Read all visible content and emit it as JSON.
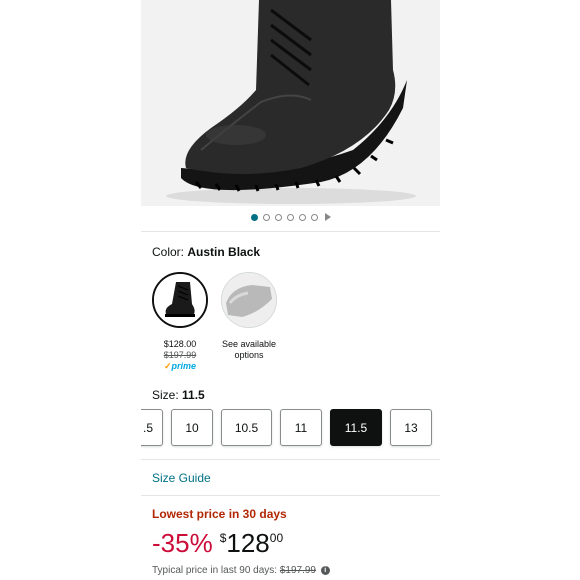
{
  "gallery": {
    "dot_count": 6,
    "active_index": 0,
    "play_icon": "play-icon"
  },
  "color": {
    "label": "Color:",
    "selected": "Austin Black",
    "swatches": [
      {
        "name": "austin-black",
        "price": "$128.00",
        "list_price": "$197.99",
        "prime": "prime"
      },
      {
        "name": "other",
        "availability_line1": "See available",
        "availability_line2": "options"
      }
    ]
  },
  "size": {
    "label": "Size:",
    "selected": "11.5",
    "options": [
      ".5",
      "10",
      "10.5",
      "11",
      "11.5",
      "13"
    ]
  },
  "size_guide": "Size Guide",
  "deal": {
    "badge": "Lowest price in 30 days",
    "discount": "-35%",
    "currency": "$",
    "price_whole": "128",
    "price_fraction": "00",
    "typical_label": "Typical price in last 90 days:",
    "typical_price": "$197.99"
  },
  "colors": {
    "link": "#007185",
    "deal_red": "#b12704",
    "discount_red": "#cc0c39",
    "selected_size_bg": "#0f1111"
  }
}
